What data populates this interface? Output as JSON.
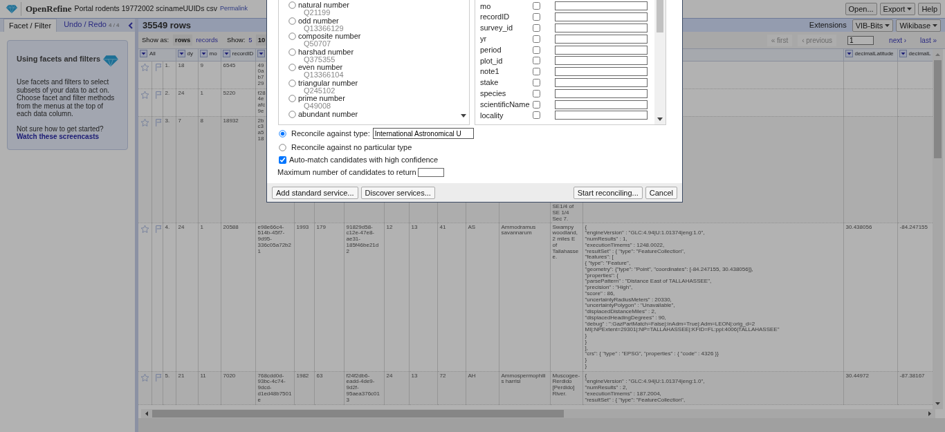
{
  "header": {
    "app_name": "OpenRefine",
    "project_title": "Portal rodents 19772002 scinameUUIDs csv",
    "permalink": "Permalink",
    "buttons": [
      {
        "label": "Open...",
        "dropdown": false
      },
      {
        "label": "Export",
        "dropdown": true
      },
      {
        "label": "Help",
        "dropdown": false
      }
    ]
  },
  "left_panel": {
    "tabs": [
      {
        "label": "Facet / Filter",
        "selected": true
      },
      {
        "label": "Undo / Redo",
        "count": "4 / 4",
        "selected": false
      }
    ],
    "help_card": {
      "title": "Using facets and filters",
      "body": "Use facets and filters to select subsets of your data to act on. Choose facet and filter methods from the menus at the top of each data column.",
      "question": "Not sure how to get started?",
      "link": "Watch these screencasts"
    }
  },
  "view": {
    "row_count": "35549 rows",
    "extensions_label": "Extensions",
    "extension_menus": [
      "VIB-Bits",
      "Wikibase"
    ],
    "show_as_label": "Show as:",
    "show_as": [
      {
        "label": "rows",
        "selected": true
      },
      {
        "label": "records",
        "selected": false
      }
    ],
    "show_label": "Show:",
    "page_sizes": [
      {
        "label": "5",
        "selected": false
      },
      {
        "label": "10",
        "selected": true
      }
    ],
    "pager": [
      {
        "label": "« first",
        "disabled": true
      },
      {
        "label": "‹ previous",
        "disabled": true
      },
      {
        "label": "next ›",
        "disabled": false
      },
      {
        "label": "last »",
        "disabled": false
      }
    ],
    "page_value": "1"
  },
  "table": {
    "headers_left": [
      "All",
      "dy",
      "mo",
      "recordID"
    ],
    "cut_header_menu": true,
    "headers_right": [
      "decimalLatitude",
      "decimalL"
    ],
    "rows": [
      {
        "number": "1.",
        "starred": false,
        "flagged": false,
        "cells": [
          "18",
          "9",
          "6545"
        ],
        "cut_cell_lines": [
          "49",
          "0a",
          "b7",
          "29"
        ]
      },
      {
        "number": "2.",
        "starred": false,
        "flagged": false,
        "cells": [
          "24",
          "1",
          "5220"
        ],
        "cut_cell_lines": [
          "f28",
          "4e",
          "afc",
          "9e"
        ]
      },
      {
        "number": "3.",
        "starred": false,
        "flagged": false,
        "cells": [
          "7",
          "8",
          "18932"
        ],
        "cut_cell_lines": [
          "2b",
          "c3",
          "a5",
          "18"
        ],
        "cut_locality": "SE1/4 of SE 1/4 Sec 7."
      },
      {
        "number": "4.",
        "starred": false,
        "flagged": false,
        "cells": [
          "24",
          "1",
          "20588",
          "e98e66c4-514b-45f7-9d95-336c05a72b21",
          "1993",
          "179",
          "91829d58-c12e-47e8-ae31-185f46be21d2",
          "12",
          "13",
          "41",
          "AS",
          "Ammodramus savannarum",
          "Swampy woodland, 2 miles E of Tallahassee.",
          "{\n\"engineVersion\" : \"GLC:4.94|U:1.01374|eng:1.0\",\n\"numResults\" : 1,\n\"executionTimems\" : 1248.0022,\n\"resultSet\" : { \"type\": \"FeatureCollection\",\n\"features\": [\n{ \"type\": \"Feature\",\n\"geometry\": {\"type\": \"Point\", \"coordinates\": [-84.247155, 30.438056]},\n\"properties\": {\n\"parsePattern\" : \"Distance East of TALLAHASSEE\",\n\"precision\" : \"High\",\n\"score\" : 86,\n\"uncertaintyRadiusMeters\" : 20330,\n\"uncertaintyPolygon\" : \"Unavailable\",\n\"displacedDistanceMiles\" : 2,\n\"displacedHeadingDegrees\" : 90,\n\"debug\" : \":GazPartMatch=False|:inAdm=True|:Adm=LEON|:orig_d=2 MI|:NPExtent=29301|:NP=TALLAHASSEE|:KFID=FL:ppl:4006|TALLAHASSEE\"\n}\n}\n ],\n\"crs\": { \"type\" : \"EPSG\", \"properties\" : { \"code\" : 4326 }}\n}\n}",
          "30.438056",
          "-84.247155"
        ]
      },
      {
        "number": "5.",
        "starred": false,
        "flagged": false,
        "cells": [
          "21",
          "11",
          "7020",
          "768cdd0d-93bc-4c74-9dcd-d1ed48b7501e",
          "1982",
          "63",
          "f24f2db6-eadd-4de9-9d2f-95aea376c013",
          "24",
          "13",
          "72",
          "AH",
          "Ammospermophilis harrisi",
          "Muscogee-Rerdido [Perdido] River.",
          "{\n\"engineVersion\" : \"GLC:4.94|U:1.01374|eng:1.0\",\n\"numResults\" : 2,\n\"executionTimems\" : 187.2004,\n\"resultSet\" : { \"type\": \"FeatureCollection\",",
          "30.44972",
          "-87.38167"
        ]
      }
    ]
  },
  "dialog": {
    "types": [
      {
        "name": "natural number",
        "id": "Q21199",
        "selected": false
      },
      {
        "name": "odd number",
        "id": "Q13366129",
        "selected": false
      },
      {
        "name": "composite number",
        "id": "Q50707",
        "selected": false
      },
      {
        "name": "harshad number",
        "id": "Q375355",
        "selected": false
      },
      {
        "name": "even number",
        "id": "Q13366104",
        "selected": false
      },
      {
        "name": "triangular number",
        "id": "Q245102",
        "selected": false
      },
      {
        "name": "prime number",
        "id": "Q49008",
        "selected": false
      },
      {
        "name": "abundant number",
        "selected": false
      }
    ],
    "columns": [
      {
        "name": "mo",
        "checked": false
      },
      {
        "name": "recordID",
        "checked": false
      },
      {
        "name": "survey_id",
        "checked": false
      },
      {
        "name": "yr",
        "checked": false
      },
      {
        "name": "period",
        "checked": false
      },
      {
        "name": "plot_id",
        "checked": false
      },
      {
        "name": "note1",
        "checked": false
      },
      {
        "name": "stake",
        "checked": false
      },
      {
        "name": "species",
        "checked": false
      },
      {
        "name": "scientificName",
        "checked": false
      },
      {
        "name": "locality",
        "checked": false
      }
    ],
    "modes": [
      {
        "label": "Reconcile against type:",
        "type_value": "International Astronomical U",
        "selected": true
      },
      {
        "label": "Reconcile against no particular type",
        "selected": false
      }
    ],
    "auto_match": {
      "label": "Auto-match candidates with high confidence",
      "checked": true
    },
    "max_candidates_label": "Maximum number of candidates to return",
    "footer_left": [
      "Add standard service...",
      "Discover services..."
    ],
    "footer_right": [
      "Start reconciling...",
      "Cancel"
    ]
  }
}
